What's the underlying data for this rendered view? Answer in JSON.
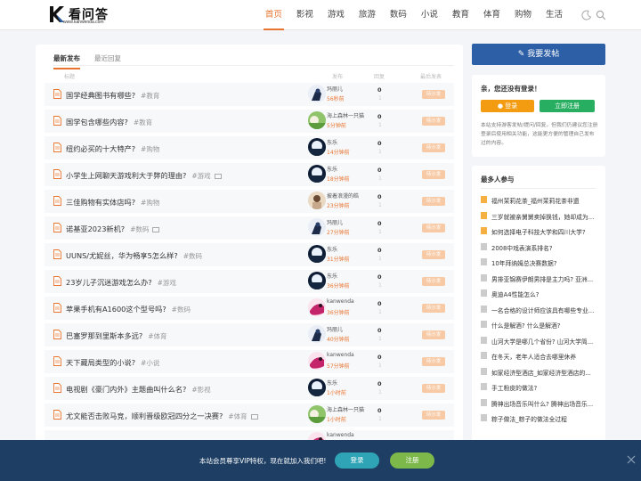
{
  "header": {
    "logo_title": "看问答",
    "logo_sub": "www.kanwenda.com",
    "nav": [
      "首页",
      "影视",
      "游戏",
      "旅游",
      "数码",
      "小说",
      "教育",
      "体育",
      "购物",
      "生活"
    ],
    "active_nav": 0,
    "accent_color": "#e8742f"
  },
  "main": {
    "tabs": [
      "最新发布",
      "最近回复"
    ],
    "columns": {
      "title": "标题",
      "author": "发布",
      "replies": "回复",
      "latest": "最后发表"
    },
    "rows": [
      {
        "title": "国学经典图书有哪些?",
        "tag": "#教育",
        "user": "玛丽儿",
        "time": "56秒前",
        "count": "0",
        "sub": "1",
        "avatar": "a1",
        "img": false
      },
      {
        "title": "国学包含哪些内容?",
        "tag": "#教育",
        "user": "海上森林一只猫",
        "time": "5分钟前",
        "count": "0",
        "sub": "1",
        "avatar": "a2",
        "img": false
      },
      {
        "title": "纽约必买的十大特产?",
        "tag": "#购物",
        "user": "东乐",
        "time": "14分钟前",
        "count": "0",
        "sub": "1",
        "avatar": "a3",
        "img": false
      },
      {
        "title": "小学生上网聊天游戏利大于弊的理由?",
        "tag": "#游戏",
        "user": "东乐",
        "time": "18分钟前",
        "count": "0",
        "sub": "1",
        "avatar": "a3",
        "img": true
      },
      {
        "title": "三佳购物有实体店吗?",
        "tag": "#购物",
        "user": "披着浪漫的皓",
        "time": "23分钟前",
        "count": "0",
        "sub": "1",
        "avatar": "a4",
        "img": false
      },
      {
        "title": "诺基亚2023新机?",
        "tag": "#数码",
        "user": "玛丽儿",
        "time": "27分钟前",
        "count": "0",
        "sub": "1",
        "avatar": "a1",
        "img": true
      },
      {
        "title": "UUNS/尤妮丝，华为畅享5怎么样?",
        "tag": "#数码",
        "user": "东乐",
        "time": "31分钟前",
        "count": "0",
        "sub": "1",
        "avatar": "a3",
        "img": false
      },
      {
        "title": "23岁儿子沉迷游戏怎么办?",
        "tag": "#游戏",
        "user": "东乐",
        "time": "36分钟前",
        "count": "0",
        "sub": "1",
        "avatar": "a3",
        "img": false
      },
      {
        "title": "苹果手机有A1600这个型号吗?",
        "tag": "#数码",
        "user": "kanwenda",
        "time": "36分钟前",
        "count": "0",
        "sub": "1",
        "avatar": "a5",
        "img": false
      },
      {
        "title": "巴塞罗那到里斯本多远?",
        "tag": "#体育",
        "user": "玛丽儿",
        "time": "40分钟前",
        "count": "0",
        "sub": "1",
        "avatar": "a1",
        "img": false
      },
      {
        "title": "天下藏局类型的小说?",
        "tag": "#小说",
        "user": "kanwenda",
        "time": "57分钟前",
        "count": "0",
        "sub": "1",
        "avatar": "a5",
        "img": false
      },
      {
        "title": "电视剧《豪门内外》主题曲叫什么名?",
        "tag": "#影视",
        "user": "东乐",
        "time": "1小时前",
        "count": "0",
        "sub": "1",
        "avatar": "a3",
        "img": false
      },
      {
        "title": "尤文能否击败马竞，顺利晋级欧冠四分之一决赛?",
        "tag": "#体育",
        "user": "海上森林一只猫",
        "time": "1小时前",
        "count": "0",
        "sub": "1",
        "avatar": "a2",
        "img": true
      },
      {
        "title": "",
        "tag": "",
        "user": "kanwenda",
        "time": "",
        "count": "",
        "sub": "",
        "avatar": "a5",
        "img": false
      }
    ],
    "badge_label": "待沙发"
  },
  "sidebar": {
    "post_button": "我要发帖",
    "login_title": "亲，您还没有登录！",
    "login_button": "登录",
    "register_button": "立即注册",
    "login_desc": "本站支持游客发帖/提问/回复。但我们仍建议您注册登录后使用相关功能，这能更方便的管理自己发布过的内容。",
    "hot_title": "最多人参与",
    "hot_items": [
      "福州茉莉花茶_福州茉莉花茶非遗",
      "三岁就被亲舅舅卖掉换钱，她却成为...",
      "如何选择电子科技大学和四川大学?",
      "2008中戏表演系排名?",
      "10年拜纳姆总决赛数据?",
      "男排亚锦赛伊朗男排是主力吗? 亚洲...",
      "奥迪A4性能怎么?",
      "一名合格的设计师应该具有哪些专业...",
      "什么是解酒? 什么是解酒?",
      "山河大学是哪几个省份? 山河大学简...",
      "在冬天，老年人适合去哪里休养",
      "如家经济型酒店_如家经济型酒店的...",
      "手工粉皮的做法?",
      "腾神出场音乐叫什么? 腾神出场音乐...",
      "粽子做法_粽子的做法全过程"
    ]
  },
  "vip_bar": {
    "text": "本站会员尊享VIP特权，现在就加入我们吧!",
    "login": "登录",
    "register": "注册"
  }
}
